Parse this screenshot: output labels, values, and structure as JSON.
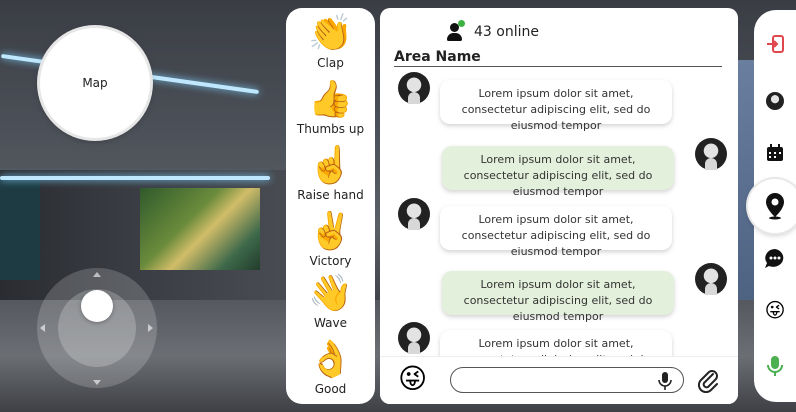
{
  "map": {
    "label": "Map"
  },
  "reactions": [
    {
      "name": "clap",
      "emoji": "👏",
      "label": "Clap"
    },
    {
      "name": "thumbs-up",
      "emoji": "👍",
      "label": "Thumbs up"
    },
    {
      "name": "raise-hand",
      "emoji": "☝️",
      "label": "Raise hand"
    },
    {
      "name": "victory",
      "emoji": "✌️",
      "label": "Victory"
    },
    {
      "name": "wave",
      "emoji": "👋",
      "label": "Wave"
    },
    {
      "name": "good",
      "emoji": "👌",
      "label": "Good"
    }
  ],
  "chat": {
    "online_text": "43 online",
    "area_name": "Area Name",
    "messages": [
      {
        "direction": "in",
        "text": "Lorem ipsum dolor sit amet, consectetur adipiscing elit, sed do eiusmod tempor"
      },
      {
        "direction": "out",
        "text": "Lorem ipsum dolor sit amet, consectetur adipiscing elit, sed do eiusmod tempor"
      },
      {
        "direction": "in",
        "text": "Lorem ipsum dolor sit amet, consectetur adipiscing elit, sed do eiusmod tempor"
      },
      {
        "direction": "out",
        "text": "Lorem ipsum dolor sit amet, consectetur adipiscing elit, sed do eiusmod tempor"
      },
      {
        "direction": "in",
        "text": "Lorem ipsum dolor sit amet, consectetur adipiscing elit, sed do eiusmod tempor"
      }
    ],
    "input": {
      "placeholder": "",
      "value": ""
    }
  },
  "toolbar": {
    "items": [
      "logout-icon",
      "user-avatar",
      "calendar-icon",
      "location-pin-icon",
      "chat-bubble-icon",
      "emoji-icon",
      "microphone-icon"
    ],
    "active": "location-pin-icon"
  },
  "colors": {
    "online_dot": "#3cb043",
    "outgoing_bubble": "#e3f0dc",
    "logout_accent": "#e0474c",
    "mic_accent": "#4caf50"
  }
}
